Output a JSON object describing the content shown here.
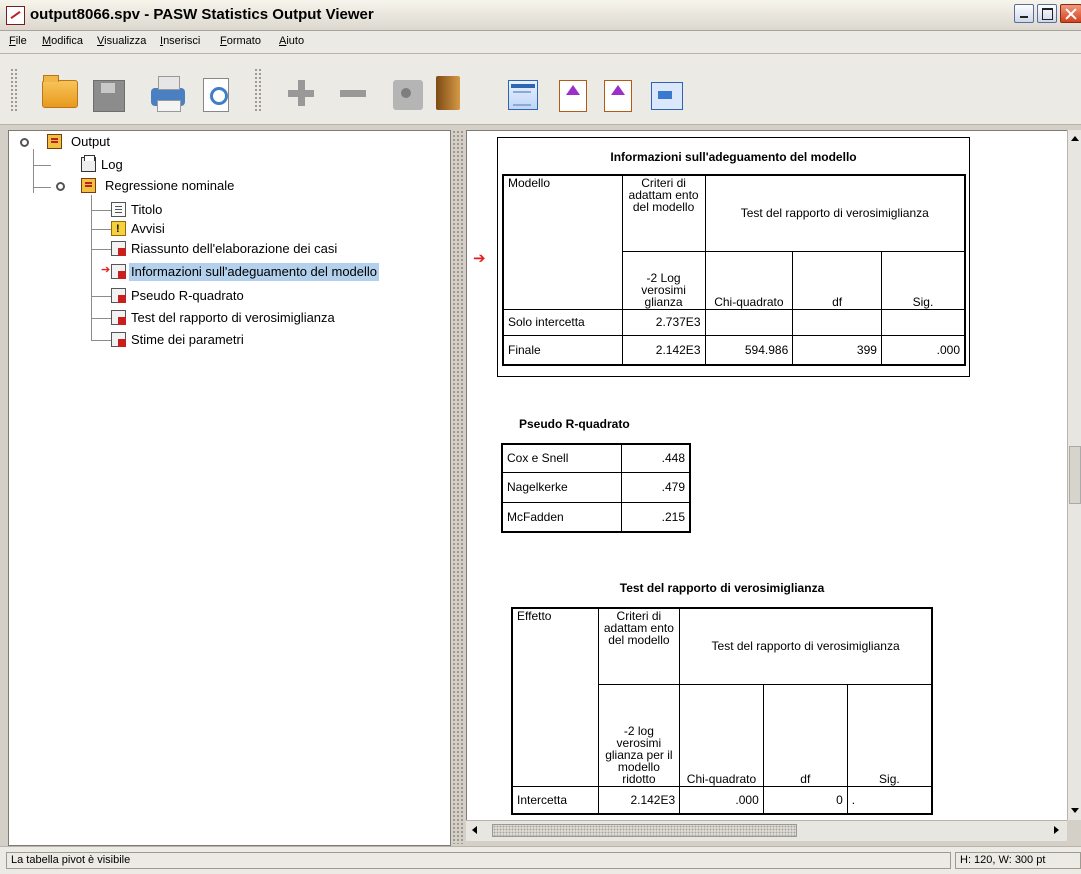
{
  "window": {
    "title": "output8066.spv - PASW Statistics Output Viewer"
  },
  "menu": [
    "File",
    "Modifica",
    "Visualizza",
    "Inserisci",
    "Formato",
    "Aiuto"
  ],
  "toolbar_icons": [
    "open-folder-icon",
    "save-icon",
    "print-icon",
    "print-preview-icon",
    "expand-plus-icon",
    "collapse-minus-icon",
    "camera-icon",
    "book-icon",
    "designate-window-icon",
    "goto-data-icon",
    "goto-case-icon",
    "export-icon"
  ],
  "outline": {
    "nodes": [
      {
        "label": "Output",
        "icon": "book-icon"
      },
      {
        "label": "Log",
        "icon": "log-icon"
      },
      {
        "label": "Regressione nominale",
        "icon": "book-icon"
      },
      {
        "label": "Titolo",
        "icon": "title-icon"
      },
      {
        "label": "Avvisi",
        "icon": "warning-icon"
      },
      {
        "label": "Riassunto dell'elaborazione dei casi",
        "icon": "table-icon"
      },
      {
        "label": "Informazioni sull'adeguamento del modello",
        "icon": "table-icon",
        "selected": true
      },
      {
        "label": "Pseudo R-quadrato",
        "icon": "table-icon"
      },
      {
        "label": "Test del rapporto di verosimiglianza",
        "icon": "table-icon"
      },
      {
        "label": "Stime dei parametri",
        "icon": "table-icon"
      }
    ]
  },
  "tables": {
    "fit": {
      "title": "Informazioni sull'adeguamento del modello",
      "h_model": "Modello",
      "h_criteria": "Criteri di adattam ento del modello",
      "h_lrt": "Test del rapporto di verosimiglianza",
      "h_m2ll": "-2 Log verosimi glianza",
      "h_chi": "Chi-quadrato",
      "h_df": "df",
      "h_sig": "Sig.",
      "rows": [
        {
          "label": "Solo intercetta",
          "m2ll": "2.737E3",
          "chi": "",
          "df": "",
          "sig": ""
        },
        {
          "label": "Finale",
          "m2ll": "2.142E3",
          "chi": "594.986",
          "df": "399",
          "sig": ".000"
        }
      ]
    },
    "pseudo": {
      "title": "Pseudo R-quadrato",
      "rows": [
        {
          "label": "Cox e Snell",
          "value": ".448"
        },
        {
          "label": "Nagelkerke",
          "value": ".479"
        },
        {
          "label": "McFadden",
          "value": ".215"
        }
      ]
    },
    "lrt": {
      "title": "Test del rapporto di verosimiglianza",
      "h_effect": "Effetto",
      "h_criteria": "Criteri di adattam ento del modello",
      "h_lrt": "Test del rapporto di verosimiglianza",
      "h_m2ll": "-2 log verosimi glianza per il modello ridotto",
      "h_chi": "Chi-quadrato",
      "h_df": "df",
      "h_sig": "Sig.",
      "rows": [
        {
          "label": "Intercetta",
          "m2ll": "2.142E3",
          "chi": ".000",
          "df": "0",
          "sig": "."
        }
      ]
    }
  },
  "status": {
    "left": "La tabella pivot è visibile",
    "right": "H: 120, W: 300 pt"
  }
}
